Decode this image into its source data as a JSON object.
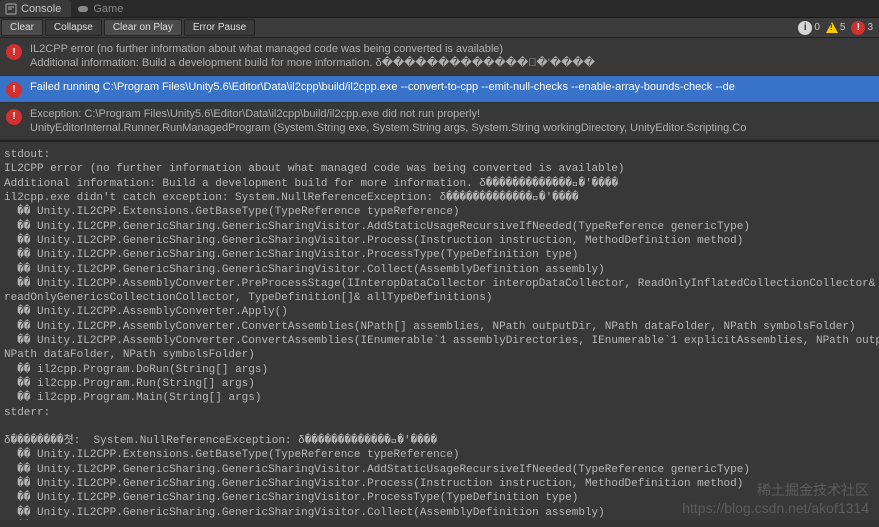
{
  "tabs": {
    "console": {
      "label": "Console"
    },
    "game": {
      "label": "Game"
    }
  },
  "toolbar": {
    "clear": "Clear",
    "collapse": "Collapse",
    "clear_on_play": "Clear on Play",
    "error_pause": "Error Pause",
    "counts": {
      "info": "0",
      "warn": "5",
      "error": "3"
    }
  },
  "log_entries": [
    {
      "line1": "IL2CPP error (no further information about what managed code was being converted is available)",
      "line2": "Additional information: Build a development build for more information. δ�������������󲻶�'����"
    },
    {
      "line1": "Failed running C:\\Program Files\\Unity5.6\\Editor\\Data\\il2cpp\\build/il2cpp.exe --convert-to-cpp --emit-null-checks --enable-array-bounds-check --de"
    },
    {
      "line1": "Exception: C:\\Program Files\\Unity5.6\\Editor\\Data\\il2cpp\\build/il2cpp.exe did not run properly!",
      "line2": "UnityEditorInternal.Runner.RunManagedProgram (System.String exe, System.String args, System.String workingDirectory, UnityEditor.Scripting.Co"
    }
  ],
  "detail": {
    "body": "stdout:\nIL2CPP error (no further information about what managed code was being converted is available)\nAdditional information: Build a development build for more information. δ�������������󲻶�'����\nil2cpp.exe didn't catch exception: System.NullReferenceException: δ�������������󲻶�'����\n  �� Unity.IL2CPP.Extensions.GetBaseType(TypeReference typeReference)\n  �� Unity.IL2CPP.GenericSharing.GenericSharingVisitor.AddStaticUsageRecursiveIfNeeded(TypeReference genericType)\n  �� Unity.IL2CPP.GenericSharing.GenericSharingVisitor.Process(Instruction instruction, MethodDefinition method)\n  �� Unity.IL2CPP.GenericSharing.GenericSharingVisitor.ProcessType(TypeDefinition type)\n  �� Unity.IL2CPP.GenericSharing.GenericSharingVisitor.Collect(AssemblyDefinition assembly)\n  �� Unity.IL2CPP.AssemblyConverter.PreProcessStage(IInteropDataCollector interopDataCollector, ReadOnlyInflatedCollectionCollector&\nreadOnlyGenericsCollectionCollector, TypeDefinition[]& allTypeDefinitions)\n  �� Unity.IL2CPP.AssemblyConverter.Apply()\n  �� Unity.IL2CPP.AssemblyConverter.ConvertAssemblies(NPath[] assemblies, NPath outputDir, NPath dataFolder, NPath symbolsFolder)\n  �� Unity.IL2CPP.AssemblyConverter.ConvertAssemblies(IEnumerable`1 assemblyDirectories, IEnumerable`1 explicitAssemblies, NPath outputDir,\nNPath dataFolder, NPath symbolsFolder)\n  �� il2cpp.Program.DoRun(String[] args)\n  �� il2cpp.Program.Run(String[] args)\n  �� il2cpp.Program.Main(String[] args)\nstderr:\n\nδ��������쳣:  System.NullReferenceException: δ�������������󲻶�'����\n  �� Unity.IL2CPP.Extensions.GetBaseType(TypeReference typeReference)\n  �� Unity.IL2CPP.GenericSharing.GenericSharingVisitor.AddStaticUsageRecursiveIfNeeded(TypeReference genericType)\n  �� Unity.IL2CPP.GenericSharing.GenericSharingVisitor.Process(Instruction instruction, MethodDefinition method)\n  �� Unity.IL2CPP.GenericSharing.GenericSharingVisitor.ProcessType(TypeDefinition type)\n  �� Unity.IL2CPP.GenericSharing.GenericSharingVisitor.Collect(AssemblyDefinition assembly)\n  �� Unity.IL2CPP.AssemblyConverter.PreProcessStage(IInteropDataCollector interopDataCollector, ReadOnlyInflatedCollectionCollector&\nreadOnlyGenericsCollectionCollector, TypeDefinition[]& allTypeDefinitions)\n  �� Unity.IL2CPP.AssemblyConverter.Apply()"
  },
  "watermark": {
    "line1": "稀土掘金技术社区",
    "line2": "https://blog.csdn.net/akof1314"
  }
}
